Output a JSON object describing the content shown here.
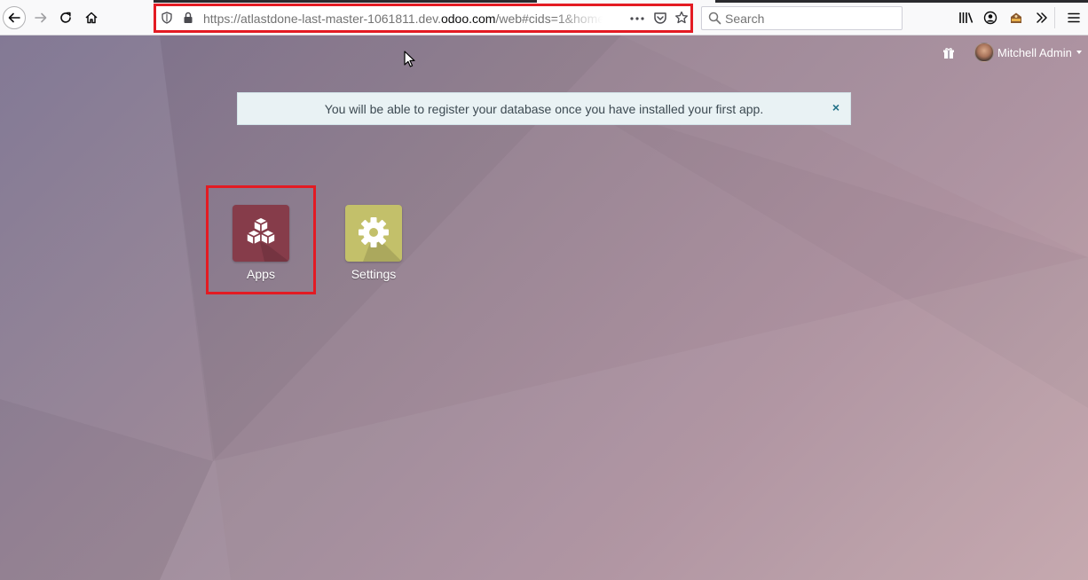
{
  "browser": {
    "url_prefix": "https://atlastdone-last-master-1061811.dev.",
    "url_host": "odoo.com",
    "url_suffix": "/web#cids=1&home",
    "search_placeholder": "Search"
  },
  "odoo": {
    "user_name": "Mitchell Admin",
    "alert_text": "You will be able to register your database once you have installed your first app.",
    "alert_close": "×",
    "apps": [
      {
        "label": "Apps",
        "color": "#863c4a"
      },
      {
        "label": "Settings",
        "color": "#c3c06a"
      }
    ]
  },
  "colors": {
    "highlight": "#e31b23",
    "background_start": "#7e7491",
    "background_end": "#c3a5ab"
  }
}
